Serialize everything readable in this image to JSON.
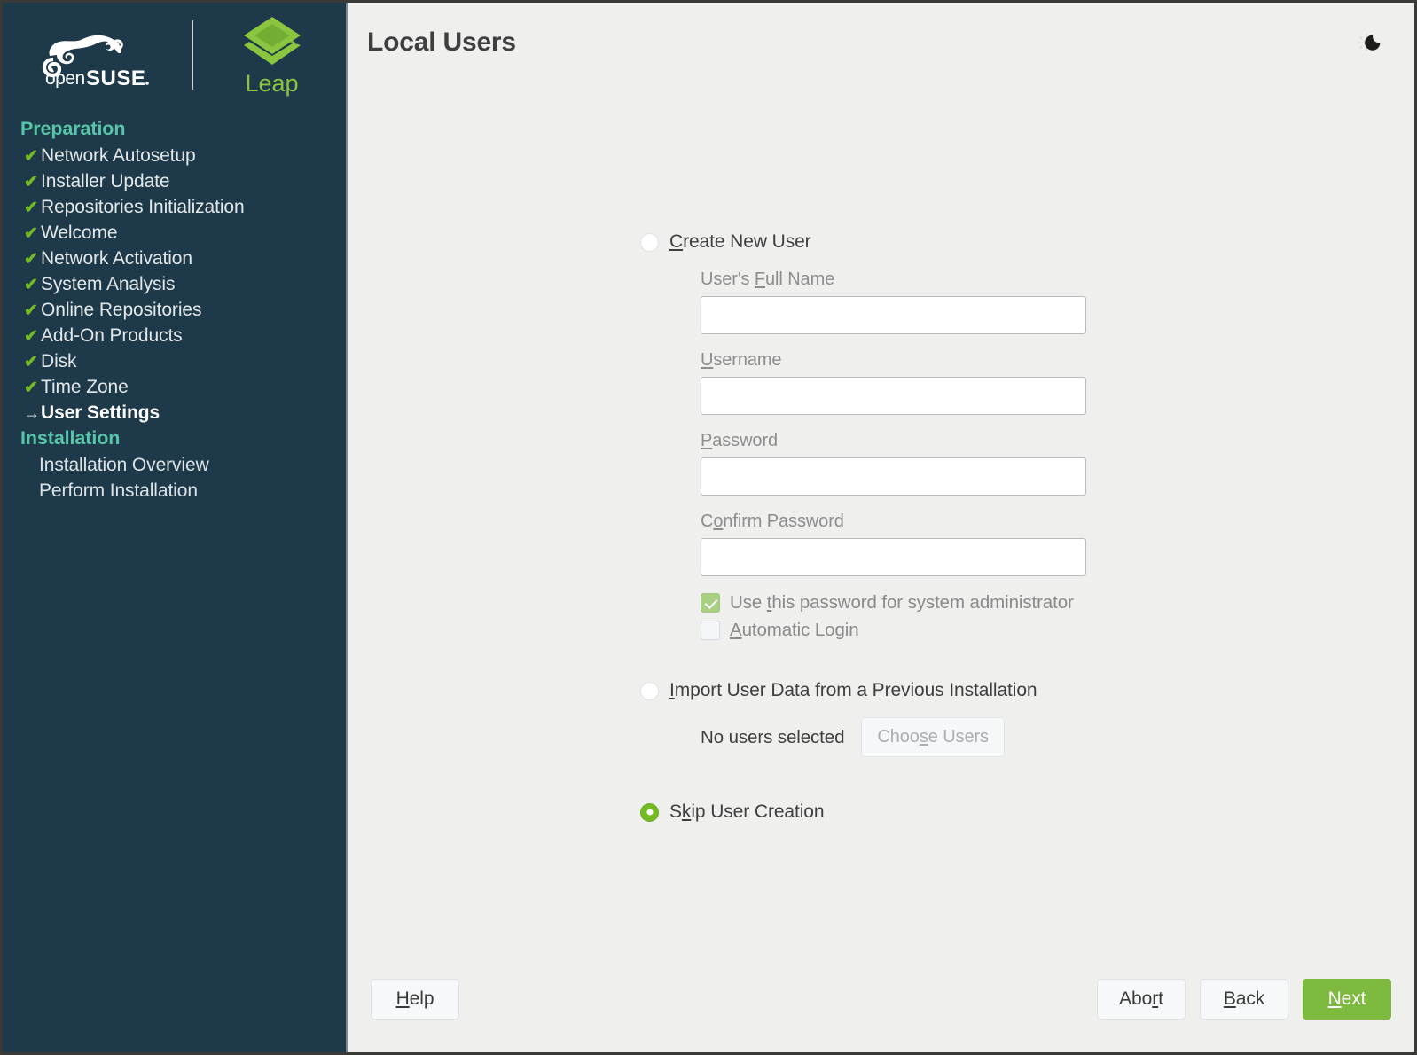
{
  "branding": {
    "product_name": "openSUSE",
    "edition": "Leap",
    "logo_icon": "chameleon-logo",
    "edition_icon": "leap-diamond-logo"
  },
  "sidebar": {
    "sections": [
      {
        "title": "Preparation",
        "items": [
          {
            "label": "Network Autosetup",
            "state": "done"
          },
          {
            "label": "Installer Update",
            "state": "done"
          },
          {
            "label": "Repositories Initialization",
            "state": "done"
          },
          {
            "label": "Welcome",
            "state": "done"
          },
          {
            "label": "Network Activation",
            "state": "done"
          },
          {
            "label": "System Analysis",
            "state": "done"
          },
          {
            "label": "Online Repositories",
            "state": "done"
          },
          {
            "label": "Add-On Products",
            "state": "done"
          },
          {
            "label": "Disk",
            "state": "done"
          },
          {
            "label": "Time Zone",
            "state": "done"
          },
          {
            "label": "User Settings",
            "state": "current"
          }
        ]
      },
      {
        "title": "Installation",
        "items": [
          {
            "label": "Installation Overview",
            "state": "pending"
          },
          {
            "label": "Perform Installation",
            "state": "pending"
          }
        ]
      }
    ],
    "done_marker": "✔",
    "current_marker": "→"
  },
  "header": {
    "title": "Local Users",
    "theme_toggle_icon": "moon-icon"
  },
  "form": {
    "create_new_user": {
      "label": "Create New User",
      "mnemonic": "C",
      "selected": false,
      "fields": [
        {
          "label": "User's Full Name",
          "mnemonic": "F",
          "value": "",
          "placeholder": ""
        },
        {
          "label": "Username",
          "mnemonic": "U",
          "value": "",
          "placeholder": ""
        },
        {
          "label": "Password",
          "mnemonic": "P",
          "value": "",
          "placeholder": ""
        },
        {
          "label": "Confirm Password",
          "mnemonic": "o",
          "value": "",
          "placeholder": ""
        }
      ],
      "checkboxes": [
        {
          "label": "Use this password for system administrator",
          "mnemonic": "t",
          "checked": true
        },
        {
          "label": "Automatic Login",
          "mnemonic": "A",
          "checked": false
        }
      ]
    },
    "import_user_data": {
      "label": "Import User Data from a Previous Installation",
      "mnemonic": "I",
      "selected": false,
      "status_text": "No users selected",
      "button_label": "Choose Users",
      "button_mnemonic": "s",
      "button_disabled": true
    },
    "skip_user_creation": {
      "label": "Skip User Creation",
      "mnemonic": "k",
      "selected": true
    }
  },
  "footer": {
    "help_label": "Help",
    "help_mnemonic": "H",
    "abort_label": "Abort",
    "abort_mnemonic": "r",
    "back_label": "Back",
    "back_mnemonic": "B",
    "next_label": "Next",
    "next_mnemonic": "N"
  },
  "colors": {
    "sidebar_bg": "#1e3a4a",
    "section_title": "#56c5a8",
    "check_green": "#73ba25",
    "leap_green": "#8bc53f",
    "primary_button": "#7fba40",
    "disabled_check": "#a9cf85"
  }
}
